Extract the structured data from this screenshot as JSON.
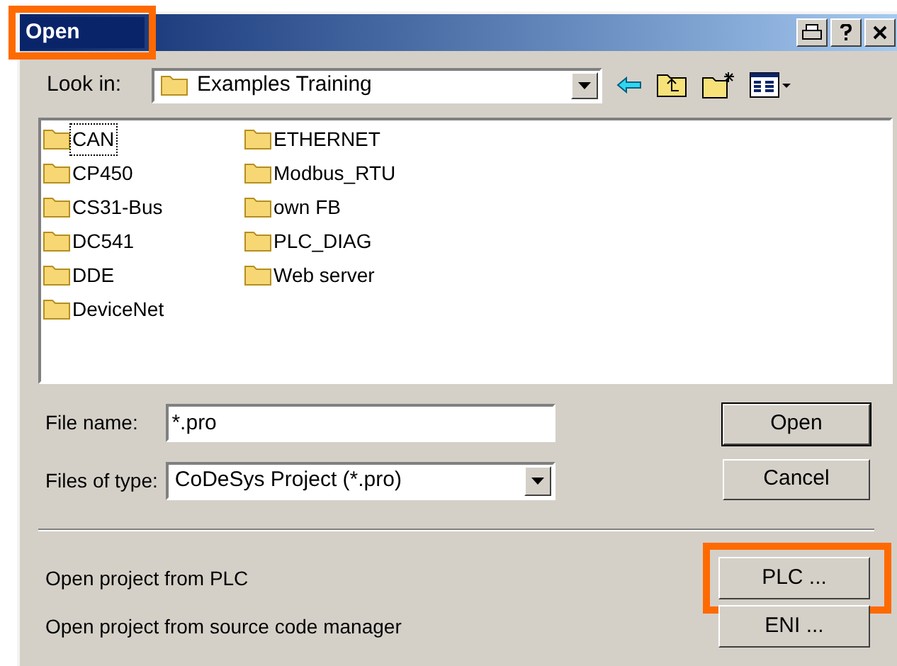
{
  "window": {
    "title": "Open",
    "highlighted": true
  },
  "look_in": {
    "label": "Look in:",
    "value": "Examples Training"
  },
  "folders": [
    {
      "name": "CAN",
      "selected": true
    },
    {
      "name": "CP450",
      "selected": false
    },
    {
      "name": "CS31-Bus",
      "selected": false
    },
    {
      "name": "DC541",
      "selected": false
    },
    {
      "name": "DDE",
      "selected": false
    },
    {
      "name": "DeviceNet",
      "selected": false
    },
    {
      "name": "ETHERNET",
      "selected": false
    },
    {
      "name": "Modbus_RTU",
      "selected": false
    },
    {
      "name": "own FB",
      "selected": false
    },
    {
      "name": "PLC_DIAG",
      "selected": false
    },
    {
      "name": "Web server",
      "selected": false
    }
  ],
  "file_name": {
    "label": "File name:",
    "value": "*.pro"
  },
  "file_type": {
    "label": "Files of type:",
    "value": "CoDeSys Project (*.pro)"
  },
  "buttons": [
    {
      "label": "Open",
      "default": true
    },
    {
      "label": "Cancel",
      "default": false
    }
  ],
  "extra_options": [
    {
      "text": "Open project from PLC",
      "button": "PLC ...",
      "highlighted": true
    },
    {
      "text": "Open project from source code manager",
      "button": "ENI ...",
      "highlighted": false
    }
  ]
}
